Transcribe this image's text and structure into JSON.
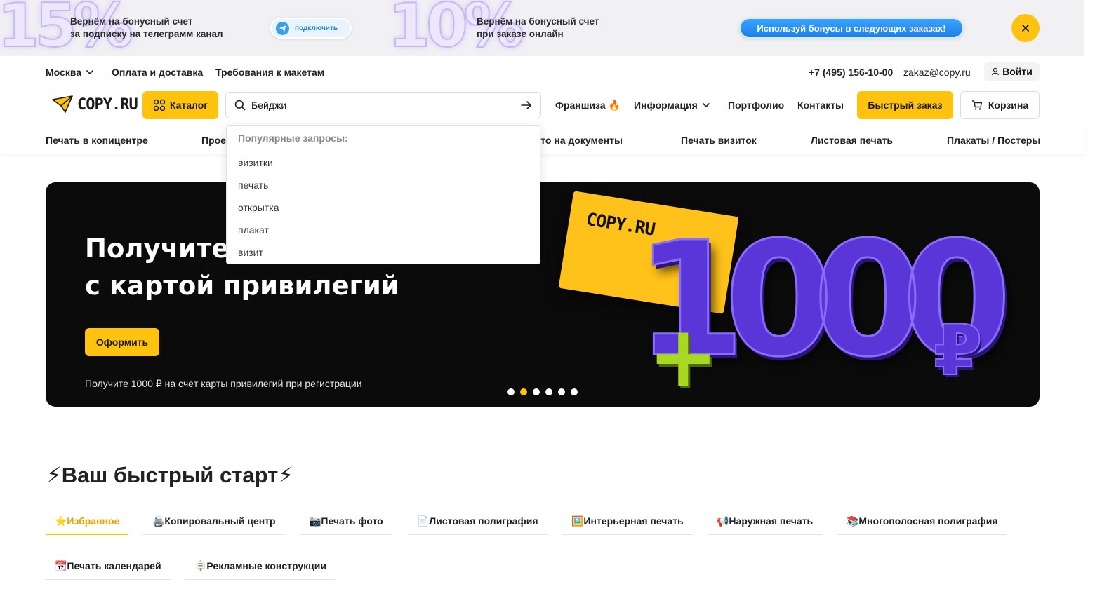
{
  "promo": {
    "offer1_big": "15%",
    "offer1_line1": "Вернём на бонусный счет",
    "offer1_line2": "за подписку на телеграмм канал",
    "telegram_button": "подключить",
    "offer2_big": "10%",
    "offer2_line1": "Вернём на бонусный счет",
    "offer2_line2": "при заказе онлайн",
    "bonus_button": "Используй бонусы в следующих заказах!"
  },
  "topbar": {
    "city": "Москва",
    "delivery": "Оплата и доставка",
    "requirements": "Требования к макетам",
    "phone": "+7 (495) 156-10-00",
    "email": "zakaz@copy.ru",
    "login": "Войти"
  },
  "header": {
    "logo": "COPY.RU",
    "catalog": "Каталог",
    "search_value": "Бейджи",
    "franchise": "Франшиза 🔥",
    "info": "Информация",
    "portfolio": "Портфолио",
    "contacts": "Контакты",
    "quick_order": "Быстрый заказ",
    "cart": "Корзина"
  },
  "catnav": {
    "items": [
      "Печать в копицентре",
      "Прое",
      "ото на документы",
      "Печать визиток",
      "Листовая печать",
      "Плакаты / Постеры"
    ]
  },
  "suggestions": {
    "heading": "Популярные запросы:",
    "items": [
      "визитки",
      "печать",
      "открытка",
      "плакат",
      "визит"
    ]
  },
  "hero": {
    "title_line1": "Получите 1",
    "title_line2": "с картой привилегий",
    "button": "Оформить",
    "subtitle": "Получите 1000 ₽ на счёт карты привилегий при регистрации",
    "card_logo": "COPY.RU",
    "plus": "+",
    "amount": "1000",
    "currency": "₽",
    "slides_count": 6,
    "active_slide": 2
  },
  "quickstart": {
    "title": "⚡Ваш быстрый старт⚡",
    "tabs": [
      "⭐Избранное",
      "🖨️Копировальный центр",
      "📷Печать фото",
      "📄Листовая полиграфия",
      "🖼️Интерьерная печать",
      "📢Наружная печать",
      "📚Многополосная полиграфия",
      "📆Печать календарей",
      "🪧Рекламные конструкции"
    ]
  },
  "colors": {
    "accent": "#ffc30f",
    "hero_bg": "#0b0b0b",
    "purple": "#5a35d8",
    "green": "#a8d81f",
    "telegram": "#3a9ee9",
    "bonus_blue": "#1d7fe6"
  }
}
